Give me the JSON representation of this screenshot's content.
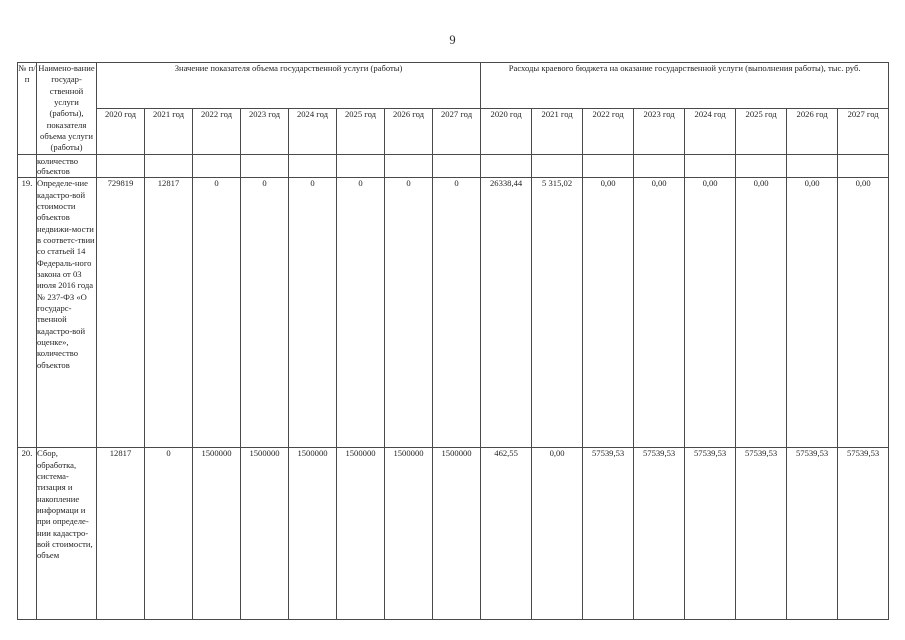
{
  "document": {
    "page_number": "9"
  },
  "table": {
    "header": {
      "col_num": "№ п/ п",
      "col_name": "Наимено-вание государ-ственной услуги (работы), показателя объема услуги (работы)",
      "group_volume": "Значение показателя объема государственной услуги (работы)",
      "group_expense": "Расходы краевого бюджета на оказание государственной услуги (выполнения работы), тыс. руб.",
      "volume_years": [
        "2020 год",
        "2021 год",
        "2022 год",
        "2023 год",
        "2024 год",
        "2025 год",
        "2026 год",
        "2027 год"
      ],
      "expense_years": [
        "2020 год",
        "2021 год",
        "2022 год",
        "2023 год",
        "2024 год",
        "2025 год",
        "2026 год",
        "2027 год"
      ]
    },
    "rows": [
      {
        "num": "",
        "name": "количество объектов",
        "volume": [
          "",
          "",
          "",
          "",
          "",
          "",
          "",
          ""
        ],
        "expense": [
          "",
          "",
          "",
          "",
          "",
          "",
          "",
          ""
        ]
      },
      {
        "num": "19.",
        "name": "Определе-ние кадастро-вой стоимости объектов недвижи-мости в соответс-твии со статьей 14 Федераль-ного закона от 03 июля 2016 года № 237-ФЗ «О государс-твенной кадастро-вой оценке», количество объектов",
        "volume": [
          "729819",
          "12817",
          "0",
          "0",
          "0",
          "0",
          "0",
          "0"
        ],
        "expense": [
          "26338,44",
          "5 315,02",
          "0,00",
          "0,00",
          "0,00",
          "0,00",
          "0,00",
          "0,00"
        ]
      },
      {
        "num": "20.",
        "name": "Сбор, обработка, система-тизация и накопление информаци и при определе-нии кадастро-вой стоимости, объем",
        "volume": [
          "12817",
          "0",
          "1500000",
          "1500000",
          "1500000",
          "1500000",
          "1500000",
          "1500000"
        ],
        "expense": [
          "462,55",
          "0,00",
          "57539,53",
          "57539,53",
          "57539,53",
          "57539,53",
          "57539,53",
          "57539,53"
        ]
      }
    ]
  }
}
